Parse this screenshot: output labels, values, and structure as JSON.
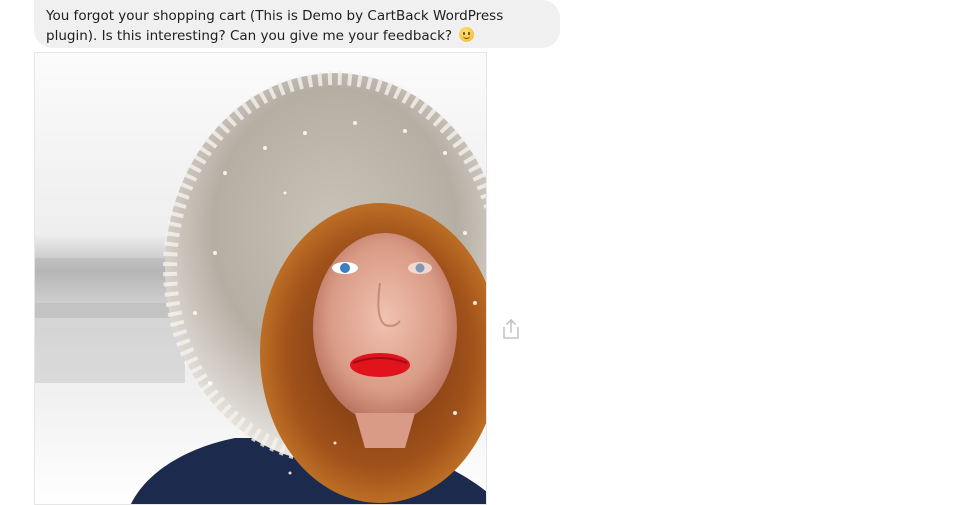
{
  "message": {
    "text": "You forgot your shopping cart (This is Demo by CartBack WordPress plugin). Is this interesting? Can you give me your feedback?",
    "emoji_icon": "smiling-face-icon"
  },
  "attachment": {
    "type": "photo",
    "subject": "portrait-woman-fur-hood-snow"
  },
  "actions": {
    "share_icon": "share-icon"
  },
  "colors": {
    "bubble_bg": "#f1f0f0",
    "text": "#1c1e21",
    "icon": "#c4c4c4"
  }
}
